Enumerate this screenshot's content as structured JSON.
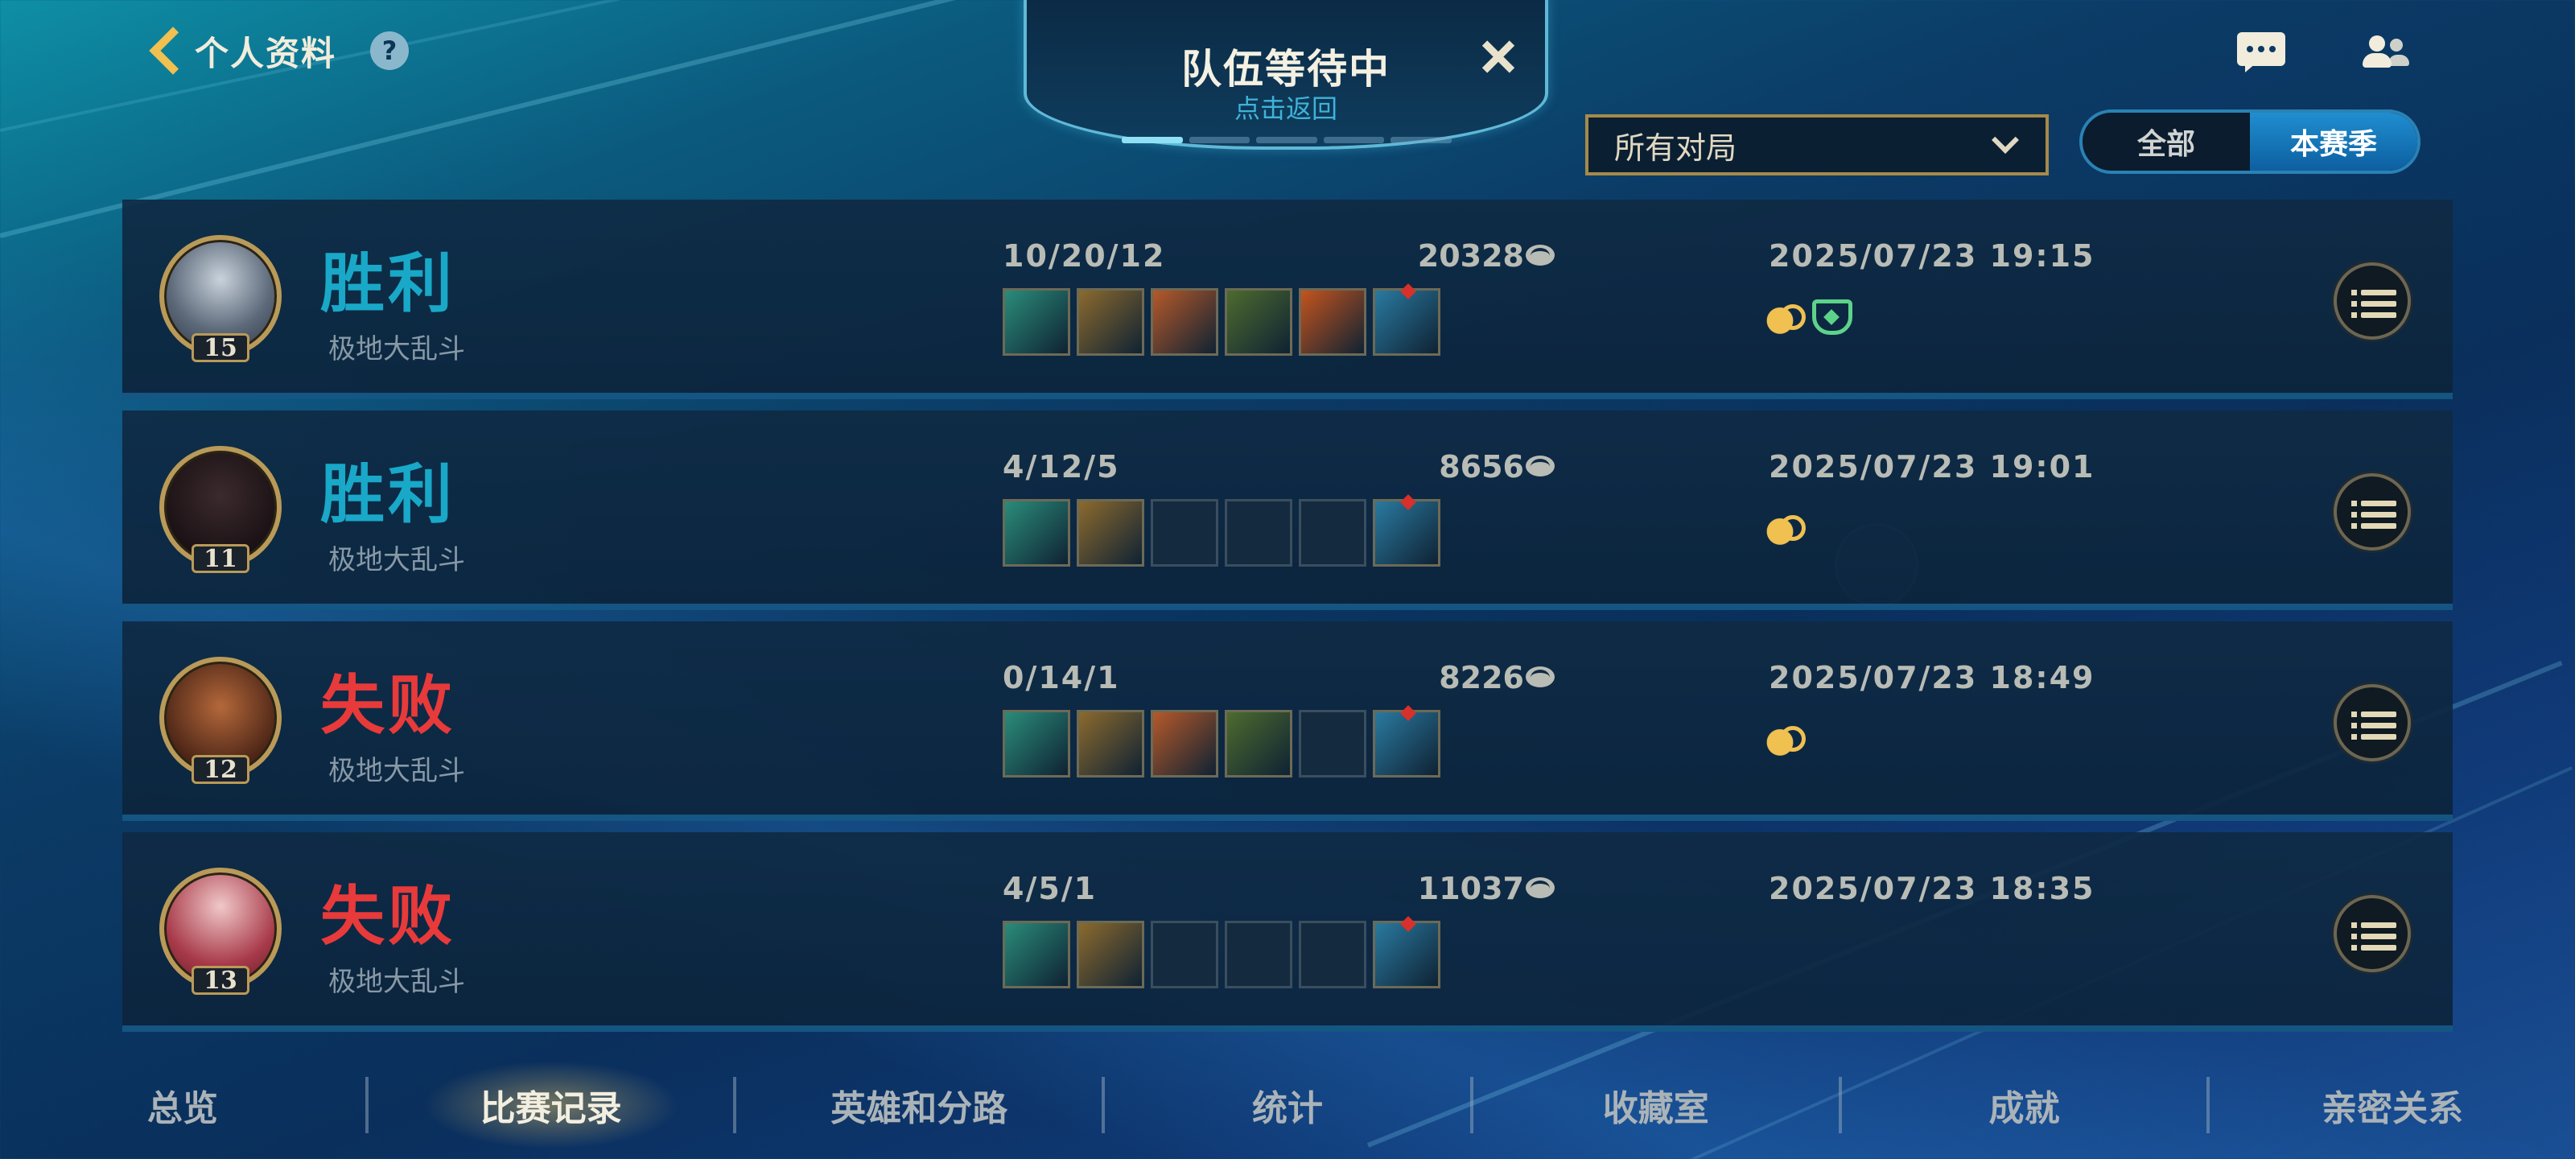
{
  "header": {
    "back_label": "个人资料",
    "help_icon": "?"
  },
  "queue": {
    "title": "队伍等待中",
    "subtitle": "点击返回",
    "progress_segments": 5,
    "progress_done": 1
  },
  "filter": {
    "selected": "所有对局"
  },
  "season_toggle": {
    "options": [
      "全部",
      "本赛季"
    ],
    "selected": "本赛季"
  },
  "matches": [
    {
      "level": "15",
      "result": "胜利",
      "result_type": "win",
      "mode": "极地大乱斗",
      "kda": "10/20/12",
      "gold": "20328",
      "date": "2025/07/23 19:15",
      "items": [
        "item-1",
        "item-2",
        "item-3",
        "item-4",
        "item-5",
        "item-6"
      ],
      "badges": [
        "gold-badge",
        "shield-badge"
      ]
    },
    {
      "level": "11",
      "result": "胜利",
      "result_type": "win",
      "mode": "极地大乱斗",
      "kda": "4/12/5",
      "gold": "8656",
      "date": "2025/07/23 19:01",
      "items": [
        "item-1",
        "item-2",
        "",
        "",
        "",
        "item-6"
      ],
      "badges": [
        "gold-badge"
      ]
    },
    {
      "level": "12",
      "result": "失败",
      "result_type": "loss",
      "mode": "极地大乱斗",
      "kda": "0/14/1",
      "gold": "8226",
      "date": "2025/07/23 18:49",
      "items": [
        "item-1",
        "item-2",
        "item-3",
        "item-4",
        "",
        "item-6"
      ],
      "badges": [
        "gold-badge"
      ]
    },
    {
      "level": "13",
      "result": "失败",
      "result_type": "loss",
      "mode": "极地大乱斗",
      "kda": "4/5/1",
      "gold": "11037",
      "date": "2025/07/23 18:35",
      "items": [
        "item-1",
        "item-2",
        "",
        "",
        "",
        "item-6"
      ],
      "badges": []
    }
  ],
  "tabs": [
    {
      "label": "总览"
    },
    {
      "label": "比赛记录",
      "active": true
    },
    {
      "label": "英雄和分路"
    },
    {
      "label": "统计"
    },
    {
      "label": "收藏室"
    },
    {
      "label": "成就"
    },
    {
      "label": "亲密关系"
    }
  ],
  "colors": {
    "win": "#19a8c8",
    "loss": "#e83a3a",
    "accent_gold": "#b99a58"
  }
}
